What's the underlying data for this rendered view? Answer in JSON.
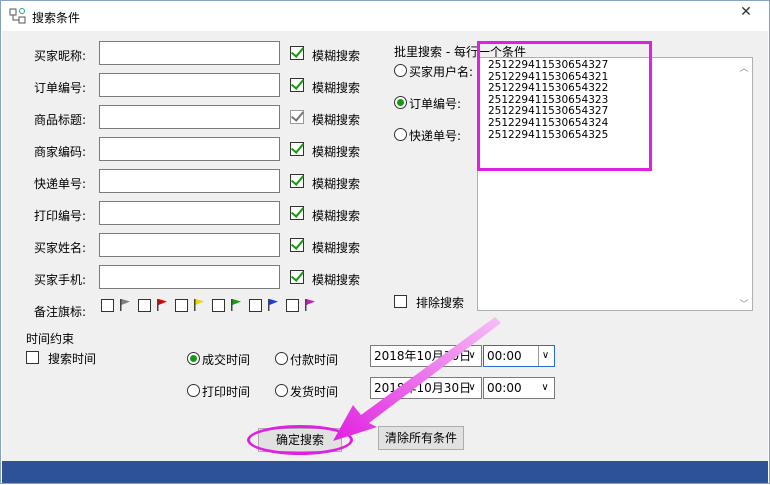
{
  "window": {
    "title": "搜索条件",
    "close": "✕"
  },
  "fields": [
    {
      "label": "买家昵称:",
      "fuzzy": "模糊搜索",
      "checked": true
    },
    {
      "label": "订单编号:",
      "fuzzy": "模糊搜索",
      "checked": true
    },
    {
      "label": "商品标题:",
      "fuzzy": "模糊搜索",
      "checked": true,
      "disabled": true
    },
    {
      "label": "商家编码:",
      "fuzzy": "模糊搜索",
      "checked": true
    },
    {
      "label": "快递单号:",
      "fuzzy": "模糊搜索",
      "checked": true
    },
    {
      "label": "打印编号:",
      "fuzzy": "模糊搜索",
      "checked": true
    },
    {
      "label": "买家姓名:",
      "fuzzy": "模糊搜索",
      "checked": true
    },
    {
      "label": "买家手机:",
      "fuzzy": "模糊搜索",
      "checked": true
    }
  ],
  "flags": {
    "label": "备注旗标:",
    "colors": [
      "#808080",
      "#e00000",
      "#e8d800",
      "#10a010",
      "#1040e0",
      "#c020c0"
    ]
  },
  "batch": {
    "title": "批里搜索 - 每行一个条件",
    "options": [
      {
        "label": "买家用户名:",
        "selected": false
      },
      {
        "label": "订单编号:",
        "selected": true
      },
      {
        "label": "快递单号:",
        "selected": false
      }
    ],
    "lines": [
      "251229411530654327",
      "251229411530654321",
      "251229411530654322",
      "251229411530654323",
      "251229411530654327",
      "251229411530654324",
      "251229411530654325"
    ],
    "exclude": "排除搜索"
  },
  "time": {
    "section": "时间约束",
    "search_time": "搜索时间",
    "opt_deal": "成交时间",
    "opt_pay": "付款时间",
    "opt_print": "打印时间",
    "opt_ship": "发货时间",
    "date1": "2018年10月30日",
    "time1": "00:00",
    "date2": "2018年10月30日",
    "time2": "00:00"
  },
  "buttons": {
    "confirm": "确定搜索",
    "clear": "清除所有条件"
  },
  "colors": {
    "accent": "#e020e0",
    "bottombar": "#2d5296",
    "check": "#119911"
  }
}
